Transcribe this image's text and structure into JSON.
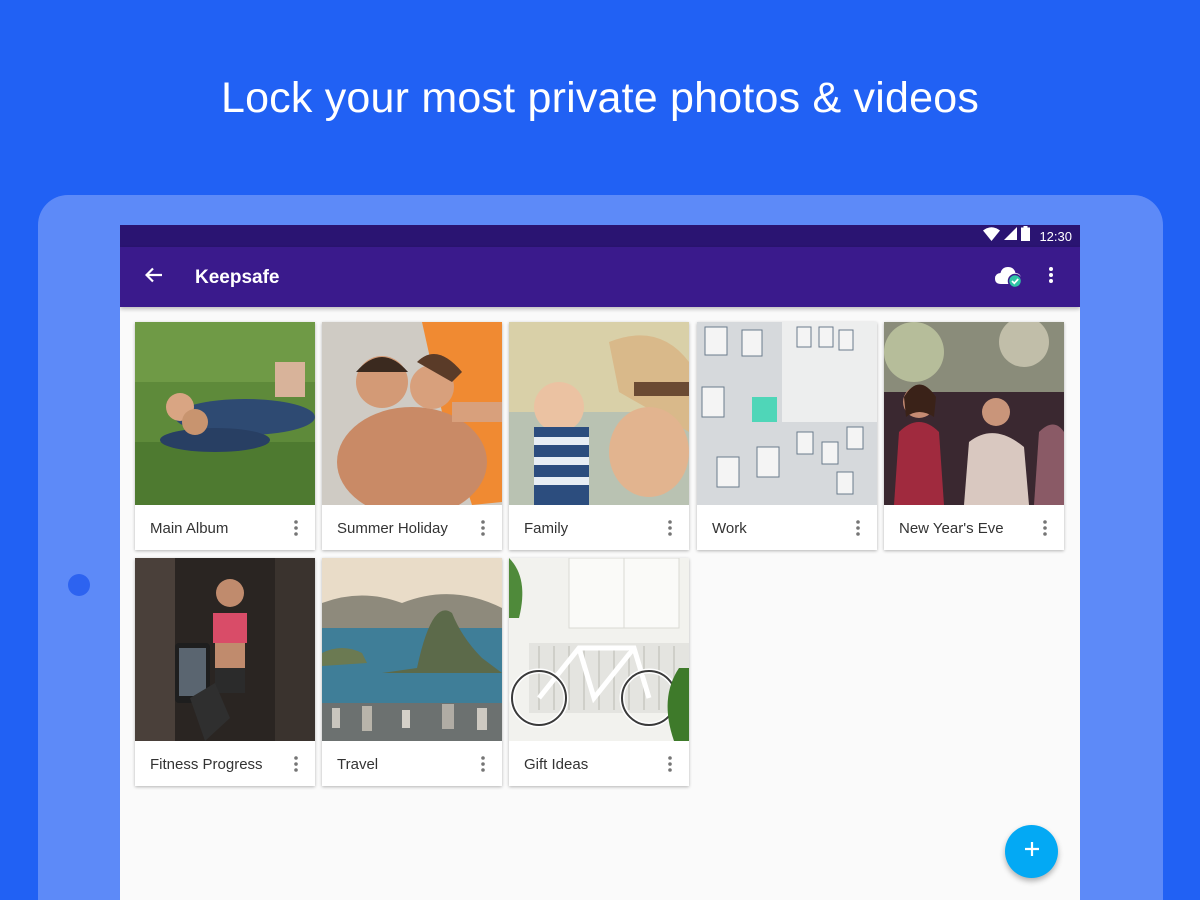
{
  "headline": "Lock your most private photos & videos",
  "status_bar": {
    "time": "12:30",
    "icons": [
      "wifi-icon",
      "signal-icon",
      "battery-icon"
    ]
  },
  "app_bar": {
    "title": "Keepsafe",
    "back_icon": "arrow-back-icon",
    "sync_icon": "cloud-check-icon",
    "menu_icon": "more-vert-icon"
  },
  "albums": [
    {
      "name": "Main Album"
    },
    {
      "name": "Summer Holiday"
    },
    {
      "name": "Family"
    },
    {
      "name": "Work"
    },
    {
      "name": "New Year's Eve"
    },
    {
      "name": "Fitness Progress"
    },
    {
      "name": "Travel"
    },
    {
      "name": "Gift Ideas"
    }
  ],
  "fab": {
    "icon": "plus-icon"
  },
  "colors": {
    "background": "#2161F4",
    "tablet": "#5D8AF8",
    "status_bar": "#2A1472",
    "app_bar": "#3A1A8C",
    "fab": "#03A9F4"
  }
}
